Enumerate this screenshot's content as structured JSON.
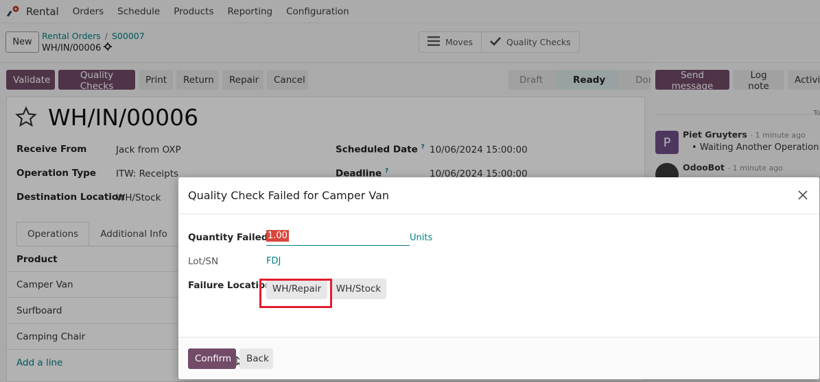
{
  "topnav": {
    "app_name": "Rental",
    "menu": [
      "Orders",
      "Schedule",
      "Products",
      "Reporting",
      "Configuration"
    ]
  },
  "control": {
    "new_label": "New",
    "breadcrumb": [
      "Rental Orders",
      "S00007"
    ],
    "record_name": "WH/IN/00006",
    "smart_buttons": [
      "Moves",
      "Quality Checks"
    ]
  },
  "actions": [
    "Validate",
    "Quality Checks",
    "Print",
    "Return",
    "Repair",
    "Cancel"
  ],
  "statusbar": {
    "stages": [
      "Draft",
      "Ready",
      "Done"
    ],
    "current": "Ready"
  },
  "form": {
    "title": "WH/IN/00006",
    "receive_from_label": "Receive From",
    "receive_from": "Jack from OXP",
    "operation_type_label": "Operation Type",
    "operation_type": "ITW: Receipts",
    "destination_label": "Destination Location",
    "destination": "WH/Stock",
    "scheduled_label": "Scheduled Date",
    "scheduled": "10/06/2024 15:00:00",
    "deadline_label": "Deadline",
    "deadline": "10/06/2024 15:00:00",
    "help_mark": "?",
    "tabs": [
      "Operations",
      "Additional Info"
    ],
    "product_header": "Product",
    "products": [
      "Camper Van",
      "Surfboard",
      "Camping Chair"
    ],
    "add_line": "Add a line"
  },
  "chatter": {
    "send_message": "Send message",
    "log_note": "Log note",
    "activities": "Activities",
    "today": "Today",
    "messages": [
      {
        "initial": "P",
        "author": "Piet Gruyters",
        "time": "- 1 minute ago",
        "body": "Waiting Another Operation"
      },
      {
        "initial": "",
        "author": "OdooBot",
        "time": "- 1 minute ago",
        "body": ""
      }
    ]
  },
  "dialog": {
    "title": "Quality Check Failed for Camper Van",
    "quantity_label": "Quantity Failed",
    "quantity_value": "1.00",
    "units": "Units",
    "lot_label": "Lot/SN",
    "lot_value": "FDJ",
    "failure_label": "Failure Location",
    "locations": [
      "WH/Repair",
      "WH/Stock"
    ],
    "confirm": "Confirm",
    "back": "Back"
  },
  "colors": {
    "primary": "#714b67",
    "link": "#017e84",
    "highlight": "#e11d2e"
  }
}
